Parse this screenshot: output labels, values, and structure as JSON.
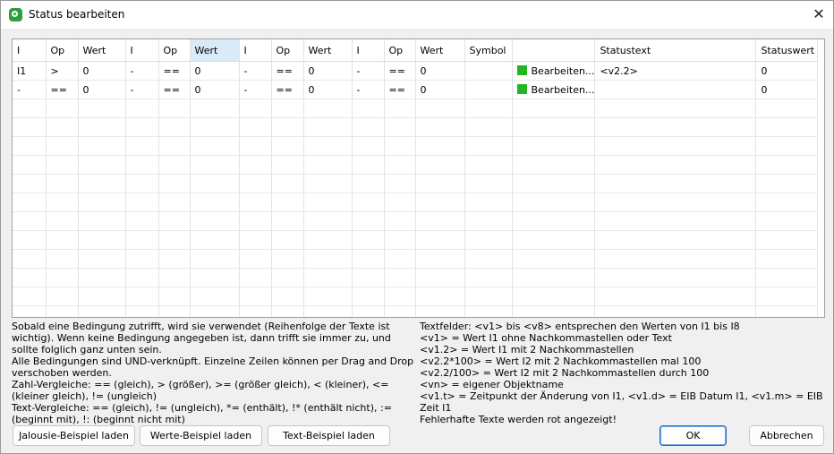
{
  "window": {
    "title": "Status bearbeiten",
    "close_glyph": "✕"
  },
  "table": {
    "columns": [
      "I",
      "Op",
      "Wert",
      "I",
      "Op",
      "Wert",
      "I",
      "Op",
      "Wert",
      "I",
      "Op",
      "Wert",
      "Symbol",
      "",
      "Statustext",
      "Statuswert"
    ],
    "selected_column": 5,
    "rows": [
      {
        "cells": [
          "I1",
          ">",
          "0",
          "-",
          "==",
          "0",
          "-",
          "==",
          "0",
          "-",
          "==",
          "0",
          "",
          "Bearbeiten...",
          "<v2.2>",
          "0"
        ],
        "symbol_color": "#22b622"
      },
      {
        "cells": [
          "-",
          "==",
          "0",
          "-",
          "==",
          "0",
          "-",
          "==",
          "0",
          "-",
          "==",
          "0",
          "",
          "Bearbeiten...",
          "",
          "0"
        ],
        "symbol_color": "#22b622"
      }
    ]
  },
  "help_left": [
    "Sobald eine Bedingung zutrifft, wird sie verwendet (Reihenfolge der Texte ist wichtig). Wenn keine Bedingung angegeben ist, dann trifft sie immer zu, und sollte folglich ganz unten sein.",
    "Alle Bedingungen sind UND-verknüpft. Einzelne Zeilen können per Drag and Drop verschoben werden.",
    "Zahl-Vergleiche: == (gleich), > (größer), >= (größer gleich), < (kleiner), <= (kleiner gleich), != (ungleich)",
    "Text-Vergleiche: == (gleich), != (ungleich), *= (enthält), !* (enthält nicht), := (beginnt mit), !: (beginnt nicht mit)"
  ],
  "help_right": [
    "Textfelder: <v1> bis <v8> entsprechen den Werten von I1 bis I8",
    "<v1> = Wert I1 ohne Nachkommastellen oder Text",
    "<v1.2> = Wert I1 mit 2 Nachkommastellen",
    "<v2.2*100> = Wert I2 mit 2 Nachkommastellen mal 100",
    "<v2.2/100> = Wert I2 mit 2 Nachkommastellen durch 100",
    "<vn> = eigener Objektname",
    "<v1.t> = Zeitpunkt der Änderung von I1, <v1.d> = EIB Datum I1, <v1.m> = EIB Zeit I1",
    "Fehlerhafte Texte werden rot angezeigt!"
  ],
  "buttons": {
    "jalousie": "Jalousie-Beispiel laden",
    "werte": "Werte-Beispiel laden",
    "text": "Text-Beispiel laden",
    "ok": "OK",
    "cancel": "Abbrechen"
  },
  "colors": {
    "accent": "#1f6fc0",
    "status_green": "#22b622",
    "selected_header": "#d9ebf9"
  }
}
